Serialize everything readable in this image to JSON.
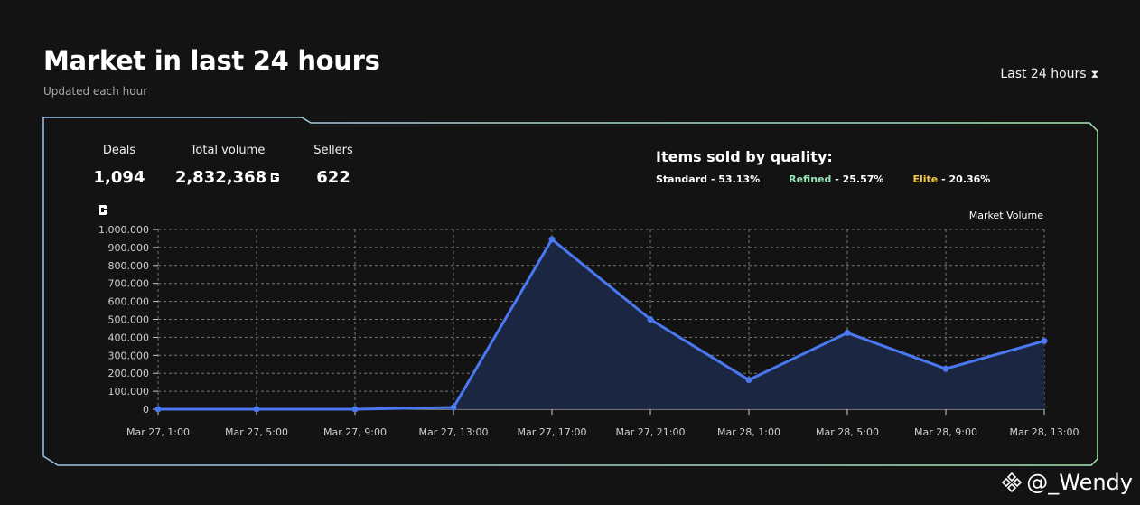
{
  "header": {
    "title": "Market in last 24 hours",
    "subtitle": "Updated each hour",
    "range_label": "Last 24 hours",
    "range_icon": "hourglass-icon"
  },
  "stats": {
    "deals_label": "Deals",
    "deals_value": "1,094",
    "volume_label": "Total volume",
    "volume_value": "2,832,368",
    "volume_icon": "coin-icon",
    "sellers_label": "Sellers",
    "sellers_value": "622"
  },
  "quality": {
    "title": "Items sold by quality:",
    "items": [
      {
        "name": "Standard",
        "value": "53.13%",
        "color": "#ffffff"
      },
      {
        "name": "Refined",
        "value": "25.57%",
        "color": "#9be3b8"
      },
      {
        "name": "Elite",
        "value": "20.36%",
        "color": "#f5c84a"
      }
    ]
  },
  "colors": {
    "line": "#4a78f0",
    "area": "#1b2745",
    "grid": "#777777",
    "frame_left": "#9cc3e8",
    "frame_right": "#a9e6b2"
  },
  "chart_data": {
    "type": "area",
    "title": "",
    "xlabel": "",
    "ylabel": "",
    "legend": "Market Volume",
    "legend_position": "top-right",
    "grid": true,
    "x": [
      "Mar 27, 1:00",
      "Mar 27, 5:00",
      "Mar 27, 9:00",
      "Mar 27, 13:00",
      "Mar 27, 17:00",
      "Mar 27, 21:00",
      "Mar 28, 1:00",
      "Mar 28, 5:00",
      "Mar 28, 9:00",
      "Mar 28, 13:00"
    ],
    "series": [
      {
        "name": "Market Volume",
        "values": [
          0,
          0,
          0,
          10000,
          945000,
          500000,
          163000,
          425000,
          225000,
          380000
        ]
      }
    ],
    "ylim": [
      0,
      1000000
    ],
    "yticks": [
      0,
      100000,
      200000,
      300000,
      400000,
      500000,
      600000,
      700000,
      800000,
      900000,
      1000000
    ],
    "ytick_labels": [
      "0",
      "100.000",
      "200.000",
      "300.000",
      "400.000",
      "500.000",
      "600.000",
      "700.000",
      "800.000",
      "900.000",
      "1.000.000"
    ]
  },
  "watermark": {
    "text": "@_Wendy",
    "icon": "binance-logo-icon"
  }
}
